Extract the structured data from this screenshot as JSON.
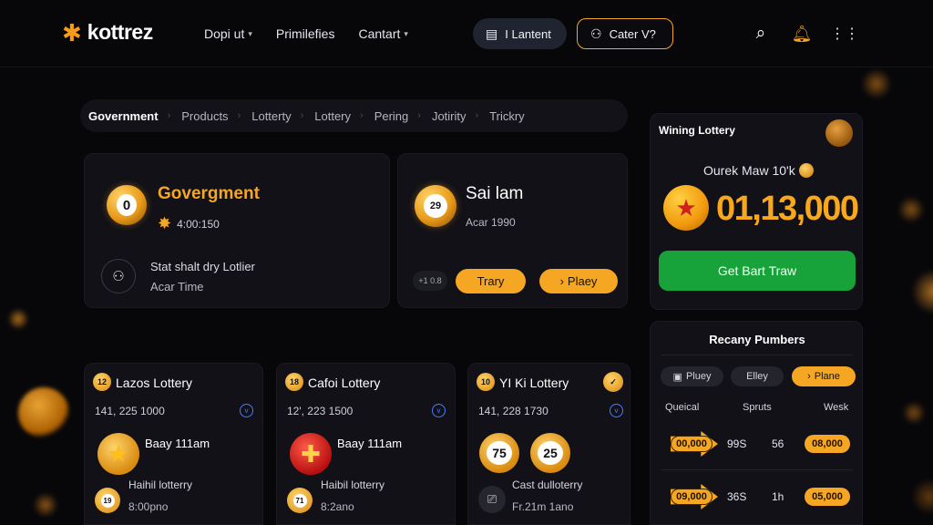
{
  "brand": {
    "name": "kottrez",
    "accent": "#f5a623",
    "green": "#18a23a"
  },
  "nav": {
    "links": [
      {
        "label": "Dopi ut",
        "has_menu": true
      },
      {
        "label": "Primilefies",
        "has_menu": false
      },
      {
        "label": "Cantart",
        "has_menu": true
      }
    ],
    "launch_label": "I Lantent",
    "cater_label": "Cater V?",
    "icons": [
      "search-icon",
      "bell-icon",
      "grid-icon"
    ]
  },
  "breadcrumbs": [
    "Government",
    "Products",
    "Lotterty",
    "Lottery",
    "Pering",
    "Jotirity",
    "Trickry"
  ],
  "card_a": {
    "ball_number": "0",
    "title": "Govergment",
    "time": "4:00:150",
    "line1": "Stat shalt dry Lotlier",
    "line2": "Acar Time"
  },
  "card_b": {
    "ball_number": "29",
    "title": "Sai lam",
    "subtitle": "Acar 1990",
    "mini": "+1 0.8",
    "btn1": "Trary",
    "btn2": "Plaey"
  },
  "winning": {
    "title": "Wining Lottery",
    "label": "Ourek Maw 10'k",
    "amount": "01,13,000",
    "cta": "Get Bart Traw"
  },
  "recent": {
    "title": "Recany Pumbers",
    "tabs": [
      "Pluey",
      "Elley",
      "Plane"
    ],
    "active_tab": "Plane",
    "headers": [
      "Queical",
      "Spruts",
      "Wesk"
    ],
    "rows": [
      {
        "num": "00,000",
        "c2": "99S",
        "c3": "56",
        "c4": "08,000"
      },
      {
        "num": "09,000",
        "c2": "36S",
        "c3": "1h",
        "c4": "05,000"
      }
    ]
  },
  "lotteries": [
    {
      "badge": "12",
      "name": "Lazos Lottery",
      "numbers": "141, 225 1000",
      "mid_text": "Baay 111am",
      "line1": "Haihil lotterry",
      "line2": "8:00pno",
      "small": "19",
      "icon": "star-ball-icon"
    },
    {
      "badge": "18",
      "name": "Cafoi Lottery",
      "numbers": "12', 223 1500",
      "mid_text": "Baay 111am",
      "line1": "Haibil lotterry",
      "line2": "8:2ano",
      "small": "71",
      "icon": "gift-ball-icon"
    },
    {
      "badge": "10",
      "name": "YI Ki Lottery",
      "numbers": "141, 228 1730",
      "balls": [
        "75",
        "25"
      ],
      "line1": "Cast dulloterry",
      "line2": "Fr.21m 1ano"
    }
  ]
}
